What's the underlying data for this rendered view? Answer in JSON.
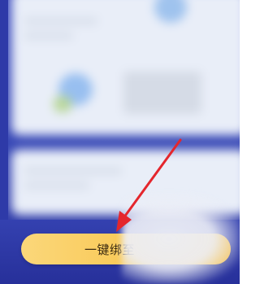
{
  "screen": {
    "background_color": "#3949b6",
    "card_color": "#e9eef8"
  },
  "primary_action": {
    "label": "一键绑至",
    "color": "#f8c752"
  },
  "annotation": {
    "arrow_icon": "red-arrow-icon",
    "arrow_color": "#e4262d"
  }
}
